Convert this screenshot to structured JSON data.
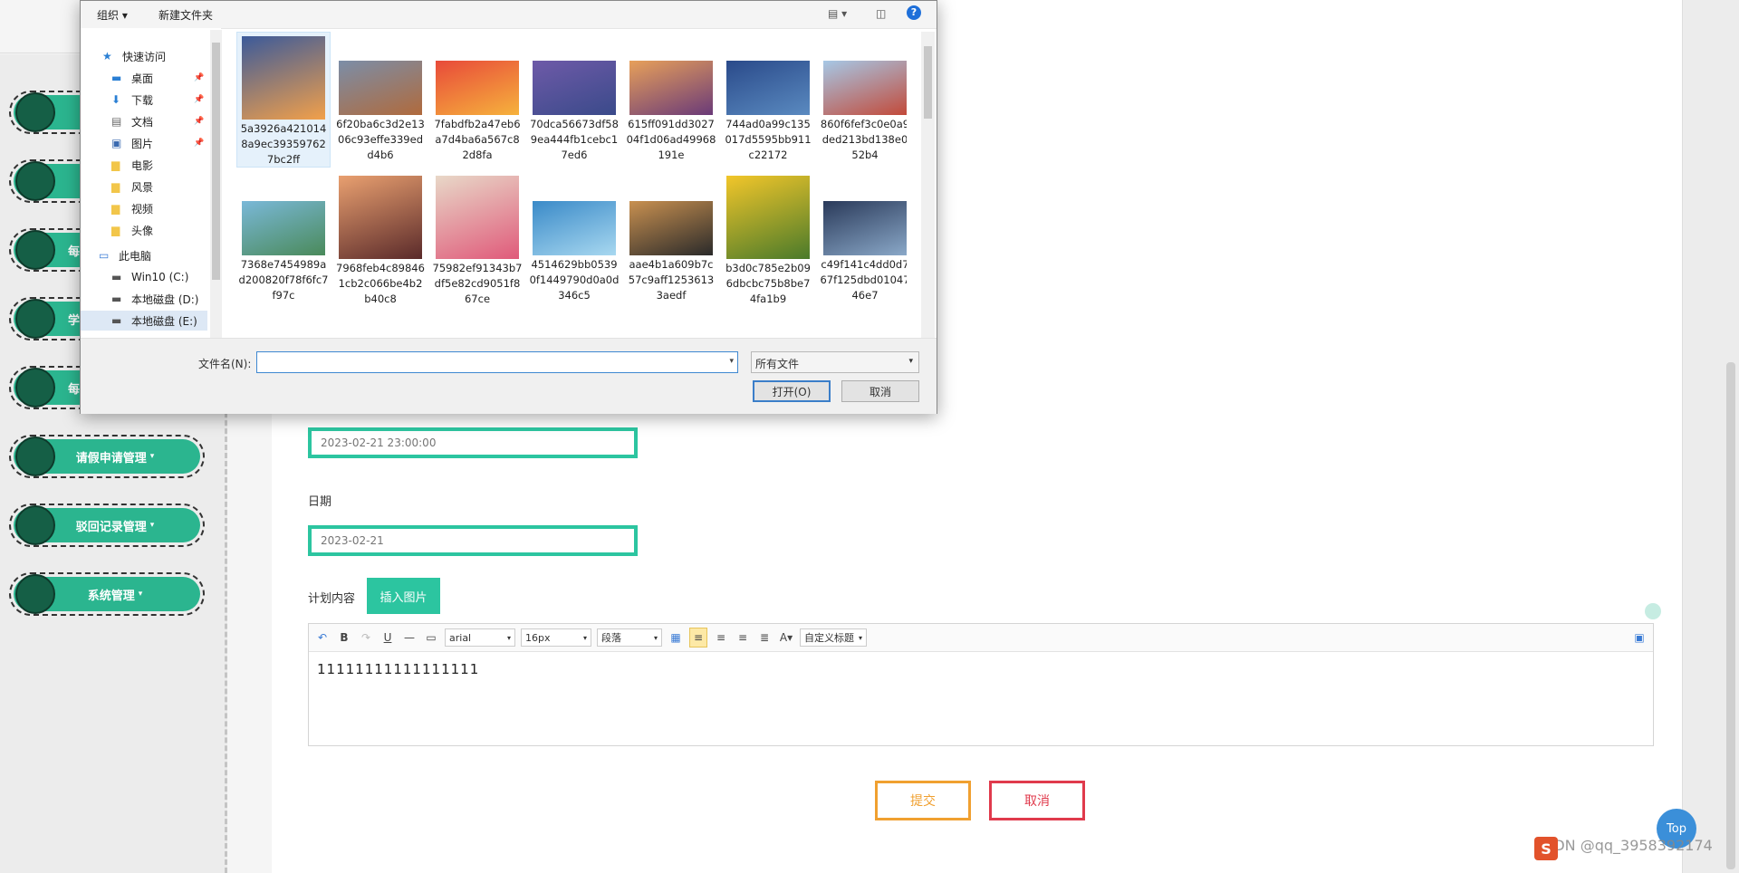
{
  "sidebar": {
    "items": [
      {
        "label": ""
      },
      {
        "label": ""
      },
      {
        "label": "每"
      },
      {
        "label": "学"
      },
      {
        "label": "每"
      },
      {
        "label": "请假申请管理"
      },
      {
        "label": "驳回记录管理"
      },
      {
        "label": "系统管理"
      }
    ]
  },
  "form": {
    "datetime_value": "2023-02-21 23:00:00",
    "date_label": "日期",
    "date_value": "2023-02-21",
    "content_label": "计划内容",
    "insert_image_label": "插入图片",
    "editor_text": "11111111111111111",
    "submit_label": "提交",
    "cancel_label": "取消"
  },
  "editor_toolbar": {
    "font": "arial",
    "size": "16px",
    "paragraph": "段落",
    "custom_title": "自定义标题",
    "bold": "B",
    "underline": "U",
    "font_color": "A"
  },
  "dialog": {
    "toolbar": {
      "organize": "组织 ▾",
      "new_folder": "新建文件夹"
    },
    "nav": [
      {
        "label": "快速访问",
        "icon": "star-icon"
      },
      {
        "label": "桌面",
        "icon": "desktop-icon",
        "pinned": true
      },
      {
        "label": "下载",
        "icon": "download-icon",
        "pinned": true
      },
      {
        "label": "文档",
        "icon": "document-icon",
        "pinned": true
      },
      {
        "label": "图片",
        "icon": "picture-icon",
        "pinned": true
      },
      {
        "label": "电影",
        "icon": "folder-icon"
      },
      {
        "label": "风景",
        "icon": "folder-icon"
      },
      {
        "label": "视频",
        "icon": "folder-icon"
      },
      {
        "label": "头像",
        "icon": "folder-icon"
      },
      {
        "label": "此电脑",
        "icon": "computer-icon"
      },
      {
        "label": "Win10 (C:)",
        "icon": "drive-icon"
      },
      {
        "label": "本地磁盘 (D:)",
        "icon": "drive-icon"
      },
      {
        "label": "本地磁盘 (E:)",
        "icon": "drive-icon"
      }
    ],
    "files": [
      {
        "name": "5a3926a4210148a9ec393597627bc2ff",
        "colors": [
          "#3b5a9a",
          "#f2a04a"
        ]
      },
      {
        "name": "6f20ba6c3d2e1306c93effe339edd4b6",
        "colors": [
          "#7b8ea8",
          "#b06a3c"
        ]
      },
      {
        "name": "7fabdfb2a47eb6a7d4ba6a567c82d8fa",
        "colors": [
          "#e84a3a",
          "#f6b23c"
        ]
      },
      {
        "name": "70dca56673df589ea444fb1cebc17ed6",
        "colors": [
          "#6e5aa8",
          "#3a4a8a"
        ]
      },
      {
        "name": "615ff091dd302704f1d06ad49968191e",
        "colors": [
          "#e7a05a",
          "#6a3a78"
        ]
      },
      {
        "name": "744ad0a99c135017d5595bb911c22172",
        "colors": [
          "#2a4a8a",
          "#5a8ac0"
        ]
      },
      {
        "name": "860f6fef3c0e0a9ded213bd138e052b4",
        "colors": [
          "#a6c8e6",
          "#c24a3a"
        ]
      },
      {
        "name": "7368e7454989ad200820f78f6fc7f97c",
        "colors": [
          "#7ab8d8",
          "#4a8a5a"
        ]
      },
      {
        "name": "7968feb4c898461cb2c066be4b2b40c8",
        "colors": [
          "#e9a070",
          "#5a2a2a"
        ]
      },
      {
        "name": "75982ef91343b7df5e82cd9051f867ce",
        "colors": [
          "#e8d8c8",
          "#e05a7a"
        ]
      },
      {
        "name": "4514629bb05390f1449790d0a0d346c5",
        "colors": [
          "#3a8ac8",
          "#a8d8f0"
        ]
      },
      {
        "name": "aae4b1a609b7c57c9aff12536133aedf",
        "colors": [
          "#c89050",
          "#2a2a2a"
        ]
      },
      {
        "name": "b3d0c785e2b096dbcbc75b8be74fa1b9",
        "colors": [
          "#f2c62a",
          "#4a7a2a"
        ]
      },
      {
        "name": "c49f141c4dd0d767f125dbd0104746e7",
        "colors": [
          "#2a3a5a",
          "#8aa8c8"
        ]
      },
      {
        "name": "",
        "colors": [
          "#4ab0d0",
          "#d8f0f8"
        ]
      }
    ],
    "filename_label": "文件名(N):",
    "filename_value": "",
    "filetype": "所有文件",
    "open_label": "打开(O)",
    "cancel_label": "取消"
  },
  "top_button": "Top",
  "watermark": "CSDN @qq_3958392174"
}
